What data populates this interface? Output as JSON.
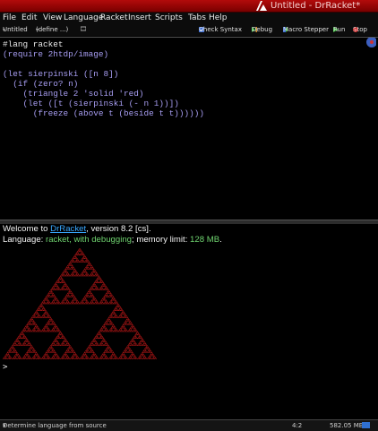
{
  "window": {
    "title": "Untitled - DrRacket*"
  },
  "menu": [
    "File",
    "Edit",
    "View",
    "Language",
    "Racket",
    "Insert",
    "Scripts",
    "Tabs",
    "Help"
  ],
  "toolbar": {
    "file_label": "Untitled",
    "define_label": "(define ...)",
    "check_syntax": "Check Syntax",
    "debug": "Debug",
    "macro_stepper": "Macro Stepper",
    "run": "Run",
    "stop": "Stop"
  },
  "editor": {
    "line1": "#lang racket",
    "line2": "(require 2htdp/image)",
    "line4": "(let sierpinski ([n 8])",
    "line5": "  (if (zero? n)",
    "line6": "    (triangle 2 'solid 'red)",
    "line7": "    (let ([t (sierpinski (- n 1))])",
    "line8": "      (freeze (above t (beside t t))))))"
  },
  "repl": {
    "welcome_prefix": "Welcome to ",
    "welcome_link": "DrRacket",
    "welcome_suffix": ", version 8.2 [cs].",
    "lang_prefix": "Language: ",
    "lang_value": "racket, with debugging",
    "mem_prefix": "; memory limit: ",
    "mem_value": "128 MB",
    "mem_suffix": ".",
    "prompt": ">"
  },
  "status": {
    "language": "Determine language from source",
    "position": "4:2",
    "memory": "582.05 MB"
  },
  "colors": {
    "titlebar": "#a00000",
    "triangle": "#c01818",
    "link": "#39a8ff",
    "green_text": "#6fd36f"
  }
}
